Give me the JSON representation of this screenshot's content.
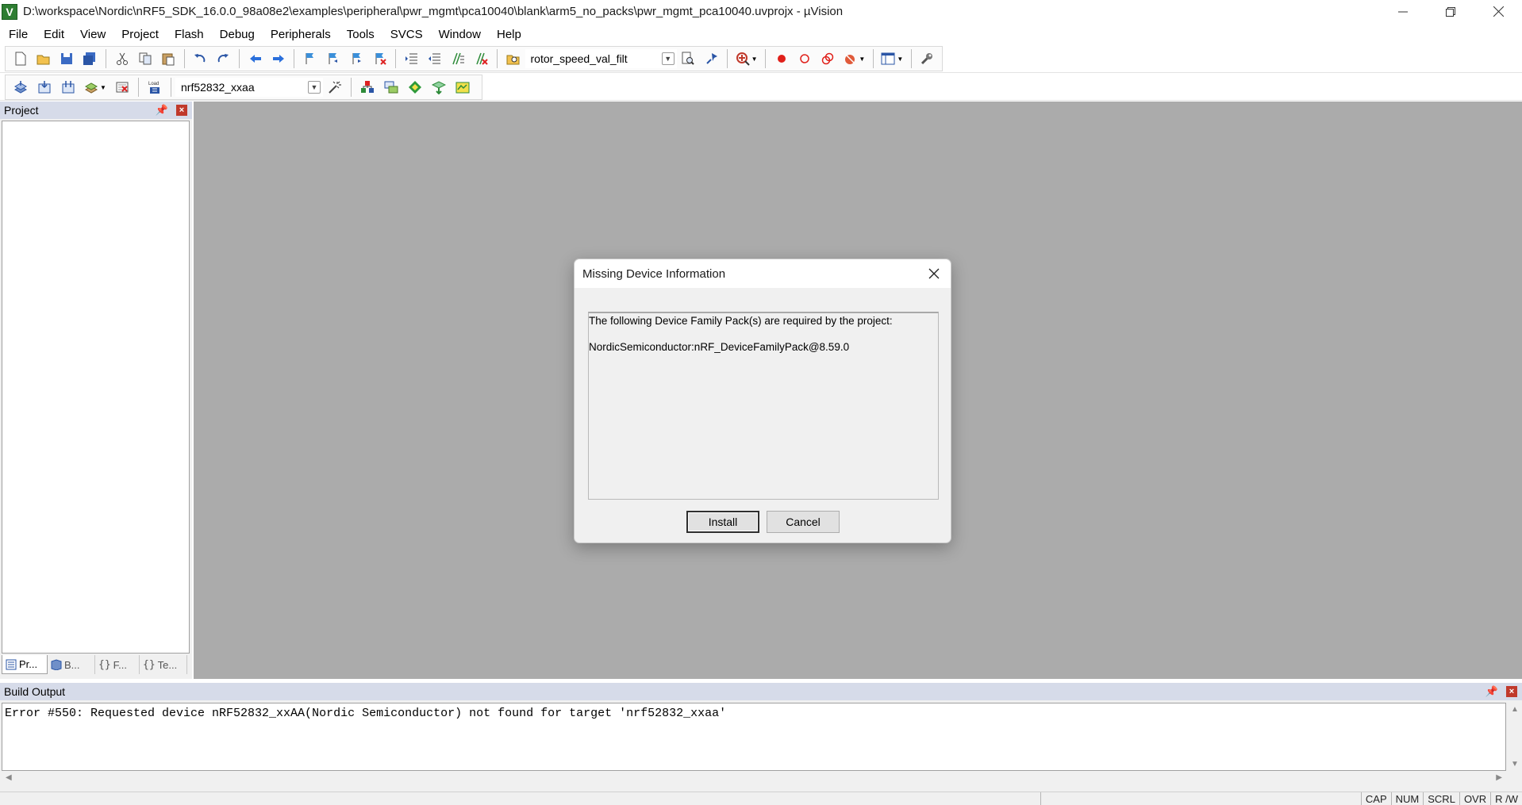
{
  "window": {
    "title": "D:\\workspace\\Nordic\\nRF5_SDK_16.0.0_98a08e2\\examples\\peripheral\\pwr_mgmt\\pca10040\\blank\\arm5_no_packs\\pwr_mgmt_pca10040.uvprojx - µVision",
    "app_icon_letter": "V"
  },
  "menu": [
    "File",
    "Edit",
    "View",
    "Project",
    "Flash",
    "Debug",
    "Peripherals",
    "Tools",
    "SVCS",
    "Window",
    "Help"
  ],
  "toolbar": {
    "find_combo_value": "rotor_speed_val_filt",
    "target_combo_value": "nrf52832_xxaa",
    "load_label": "Load"
  },
  "project_pane": {
    "title": "Project",
    "tabs": [
      "Pr...",
      "B...",
      "F...",
      "Te..."
    ]
  },
  "dialog": {
    "title": "Missing Device Information",
    "line1": "The following Device Family Pack(s) are required by the project:",
    "line2": "NordicSemiconductor:nRF_DeviceFamilyPack@8.59.0",
    "install_label": "Install",
    "cancel_label": "Cancel"
  },
  "build_output": {
    "title": "Build Output",
    "text": "Error #550: Requested device nRF52832_xxAA(Nordic Semiconductor) not found for target 'nrf52832_xxaa'"
  },
  "status_bar": [
    "CAP",
    "NUM",
    "SCRL",
    "OVR",
    "R /W"
  ],
  "colors": {
    "editor_background": "#ababab",
    "pane_header": "#d6dbe9",
    "close_red": "#c0392b"
  }
}
